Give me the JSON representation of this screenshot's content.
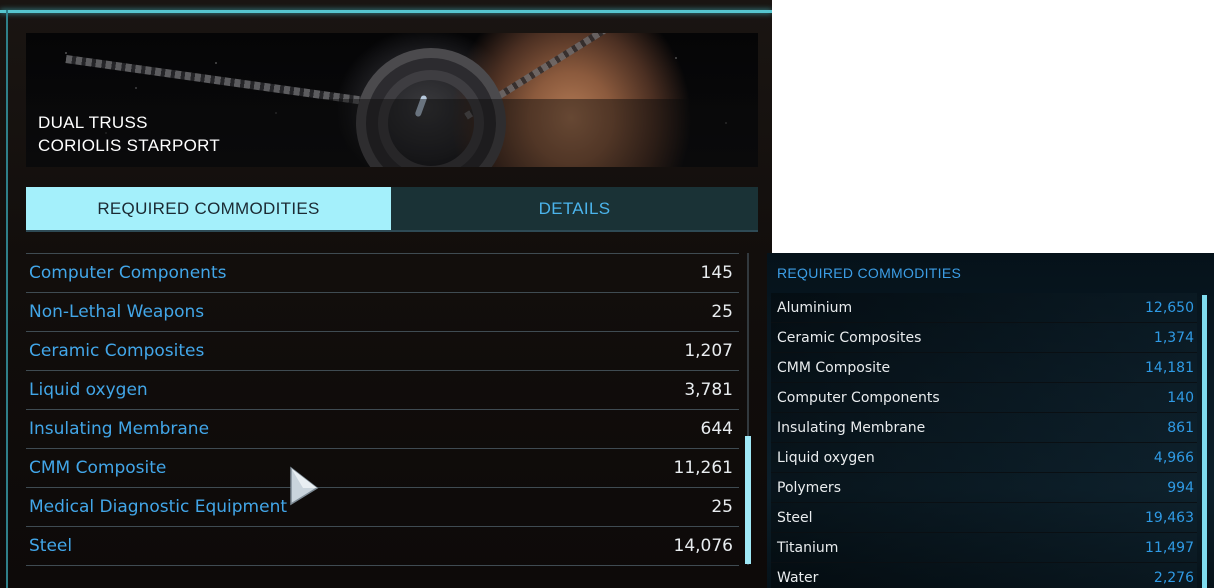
{
  "station": {
    "title_line1": "DUAL TRUSS",
    "title_line2": "CORIOLIS STARPORT"
  },
  "tabs": [
    {
      "label": "REQUIRED COMMODITIES",
      "active": true
    },
    {
      "label": "DETAILS",
      "active": false
    }
  ],
  "commodities": [
    {
      "name": "Computer Components",
      "qty": "145"
    },
    {
      "name": "Non-Lethal Weapons",
      "qty": "25"
    },
    {
      "name": "Ceramic Composites",
      "qty": "1,207"
    },
    {
      "name": "Liquid oxygen",
      "qty": "3,781"
    },
    {
      "name": "Insulating Membrane",
      "qty": "644"
    },
    {
      "name": "CMM Composite",
      "qty": "11,261"
    },
    {
      "name": "Medical Diagnostic Equipment",
      "qty": "25"
    },
    {
      "name": "Steel",
      "qty": "14,076"
    }
  ],
  "right_panel": {
    "heading": "REQUIRED COMMODITIES",
    "items": [
      {
        "name": "Aluminium",
        "qty": "12,650"
      },
      {
        "name": "Ceramic Composites",
        "qty": "1,374"
      },
      {
        "name": "CMM Composite",
        "qty": "14,181"
      },
      {
        "name": "Computer Components",
        "qty": "140"
      },
      {
        "name": "Insulating Membrane",
        "qty": "861"
      },
      {
        "name": "Liquid oxygen",
        "qty": "4,966"
      },
      {
        "name": "Polymers",
        "qty": "994"
      },
      {
        "name": "Steel",
        "qty": "19,463"
      },
      {
        "name": "Titanium",
        "qty": "11,497"
      },
      {
        "name": "Water",
        "qty": "2,276"
      }
    ]
  },
  "icons": {
    "cursor": "pointer-cursor-icon"
  },
  "colors": {
    "accent_cyan": "#a4f0fb",
    "link_blue": "#42a6e8",
    "value_white": "#e8ecef",
    "right_value_blue": "#2f9ae4"
  }
}
